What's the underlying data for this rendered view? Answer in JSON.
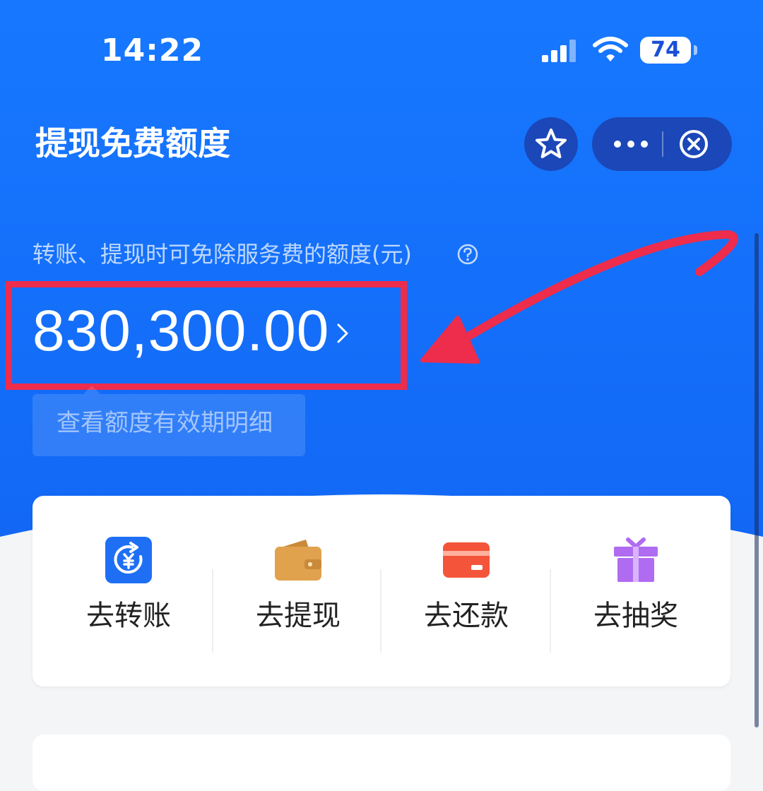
{
  "status_bar": {
    "time": "14:22",
    "battery": "74",
    "icons": [
      "signal-icon",
      "wifi-icon",
      "battery-icon"
    ]
  },
  "nav": {
    "title": "提现免费额度",
    "icons": [
      "star-icon",
      "more-icon",
      "close-icon"
    ]
  },
  "quota": {
    "label": "转账、提现时可免除服务费的额度(元)",
    "amount": "830,300.00",
    "detail_link": "查看额度有效期明细",
    "icons": [
      "help-icon",
      "chevron-right-icon"
    ]
  },
  "actions": [
    {
      "label": "去转账",
      "icon": "transfer-yuan-icon",
      "color": "#1f6ff5"
    },
    {
      "label": "去提现",
      "icon": "wallet-icon",
      "color": "#e0a24c"
    },
    {
      "label": "去还款",
      "icon": "credit-card-icon",
      "color": "#f4553a"
    },
    {
      "label": "去抽奖",
      "icon": "gift-icon",
      "color": "#b06cf0"
    }
  ],
  "colors": {
    "primary_blue": "#1673ff",
    "highlight_red": "#ee2c4c",
    "nav_button_bg": "#1b47b8"
  }
}
